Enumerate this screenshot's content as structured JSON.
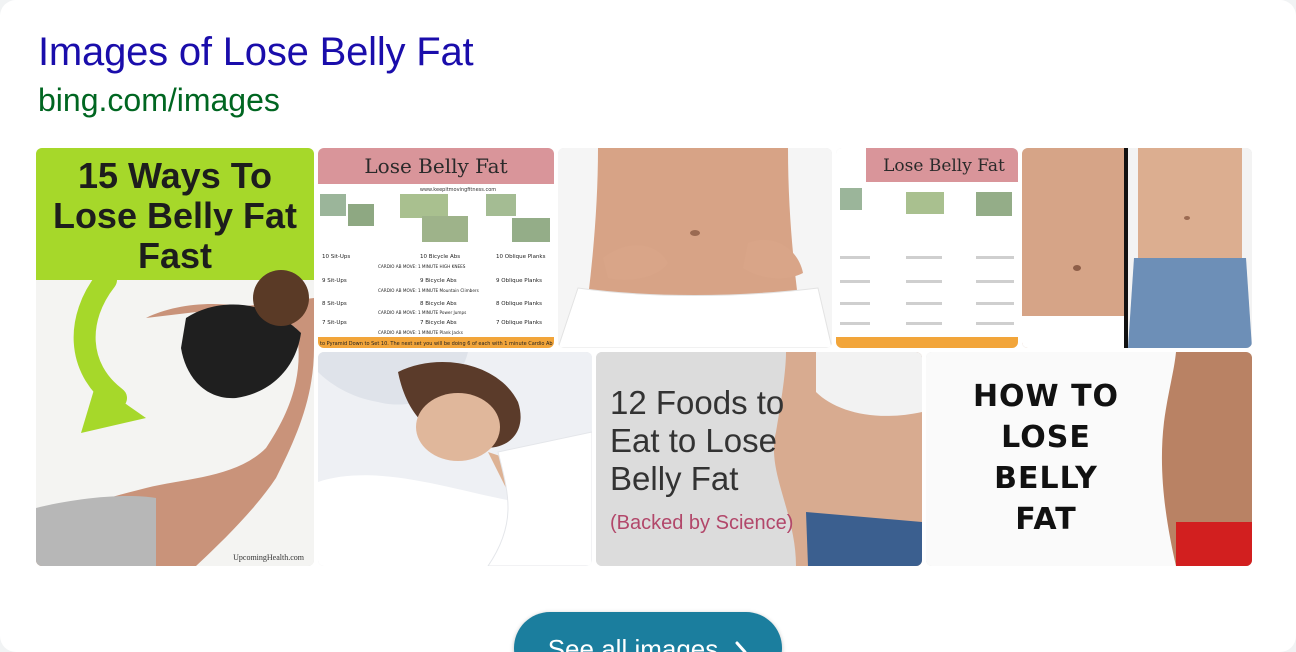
{
  "header": {
    "title": "Images of Lose Belly Fat",
    "source": "bing.com/images"
  },
  "tiles": [
    {
      "alt": "15 Ways To Lose Belly Fat Fast",
      "lines": [
        "15 Ways To",
        "Lose Belly Fat",
        "Fast"
      ],
      "credit": "UpcomingHealth.com"
    },
    {
      "alt": "Lose Belly Fat workout chart",
      "heading": "Lose Belly Fat",
      "site": "www.keepitmovingfitness.com",
      "rows": [
        {
          "a": "10 Sit-Ups",
          "b": "10 Bicycle Abs",
          "c": "10 Oblique Planks",
          "note": "CARDIO AB MOVE: 1 MINUTE  HIGH KNEES"
        },
        {
          "a": "9 Sit-Ups",
          "b": "9 Bicycle Abs",
          "c": "9 Oblique Planks",
          "note": "CARDIO AB MOVE: 1 MINUTE  Mountain Climbers"
        },
        {
          "a": "8 Sit-Ups",
          "b": "8 Bicycle Abs",
          "c": "8 Oblique Planks",
          "note": "CARDIO AB MOVE: 1 MINUTE  Power Jumps"
        },
        {
          "a": "7 Sit-Ups",
          "b": "7 Bicycle Abs",
          "c": "7 Oblique Planks",
          "note": "CARDIO AB MOVE: 1 MINUTE  Plank Jacks"
        }
      ],
      "footer": "to Pyramid Down to Set 10. The next set you will be doing 6 of each with 1 minute Cardio Ab"
    },
    {
      "alt": "Woman pinching belly fat"
    },
    {
      "alt": "Lose Belly Fat workout chart (small)",
      "heading": "Lose Belly Fat"
    },
    {
      "alt": "Before and after belly comparison"
    },
    {
      "alt": "Woman sleeping"
    },
    {
      "alt": "12 Foods to Eat to Lose Belly Fat",
      "lines": [
        "12 Foods to",
        "Eat to Lose",
        "Belly Fat"
      ],
      "sub": "(Backed by Science)"
    },
    {
      "alt": "How To Lose Belly Fat",
      "lines": [
        "HOW TO",
        "LOSE",
        "BELLY",
        "FAT"
      ]
    }
  ],
  "button": {
    "label": "See all images"
  },
  "colors": {
    "title": "#1a0dab",
    "source": "#006621",
    "button": "#1b7e9e",
    "lime": "#a6d82a"
  }
}
